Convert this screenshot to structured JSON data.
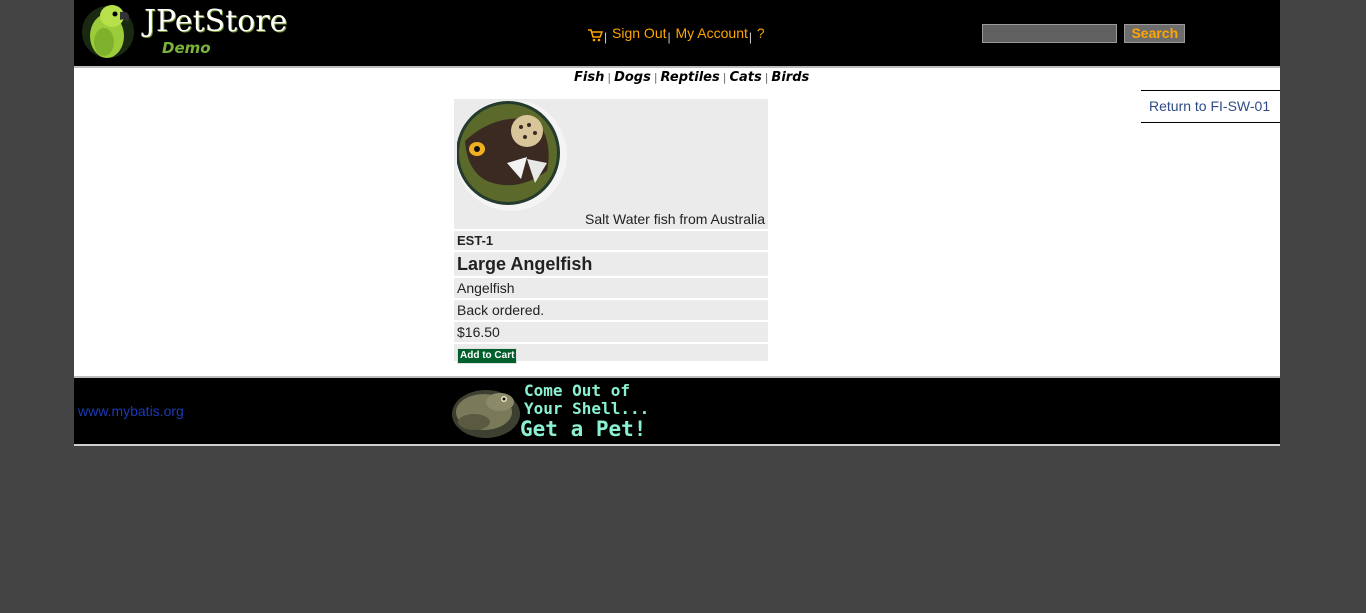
{
  "header": {
    "logo_title": "JPetStore",
    "logo_subtitle": "Demo",
    "menu": {
      "cart_icon": "cart-icon",
      "sign_out": "Sign Out",
      "my_account": "My Account",
      "help": "?"
    },
    "search": {
      "placeholder": "",
      "value": "",
      "button_label": "Search"
    }
  },
  "quick_links": [
    "Fish",
    "Dogs",
    "Reptiles",
    "Cats",
    "Birds"
  ],
  "back_link": "Return to FI-SW-01",
  "item": {
    "description": "Salt Water fish from Australia",
    "id": "EST-1",
    "name": "Large Angelfish",
    "attribute": "Angelfish",
    "stock": "Back ordered.",
    "price": "$16.50",
    "add_to_cart": "Add to Cart"
  },
  "footer": {
    "link": "www.mybatis.org",
    "banner_line1": "Come Out of",
    "banner_line2": "Your Shell...",
    "banner_line3": "Get a Pet!"
  },
  "colors": {
    "page_bg": "#444444",
    "header_bg": "#000000",
    "menu_link": "#ffa500",
    "add_to_cart_bg": "#005f2b",
    "back_link": "#2e4b86"
  }
}
